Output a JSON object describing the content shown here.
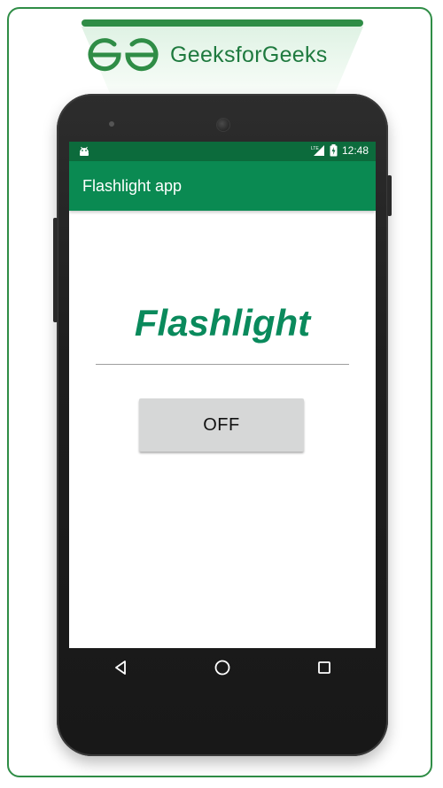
{
  "brand": {
    "name": "GeeksforGeeks",
    "color": "#2f8d46",
    "logo_icon": "gfg-logo-icon"
  },
  "status_bar": {
    "time": "12:48",
    "icons": [
      "android-icon",
      "lte-signal-icon",
      "battery-charging-icon"
    ],
    "color": "#0c6b3c"
  },
  "app_bar": {
    "title": "Flashlight app",
    "color": "#0a8a52"
  },
  "main": {
    "heading": "Flashlight",
    "heading_color": "#0a8a5c",
    "toggle_button": {
      "label": "OFF"
    }
  },
  "nav_bar": {
    "icons": [
      "back-icon",
      "home-icon",
      "recents-icon"
    ]
  }
}
